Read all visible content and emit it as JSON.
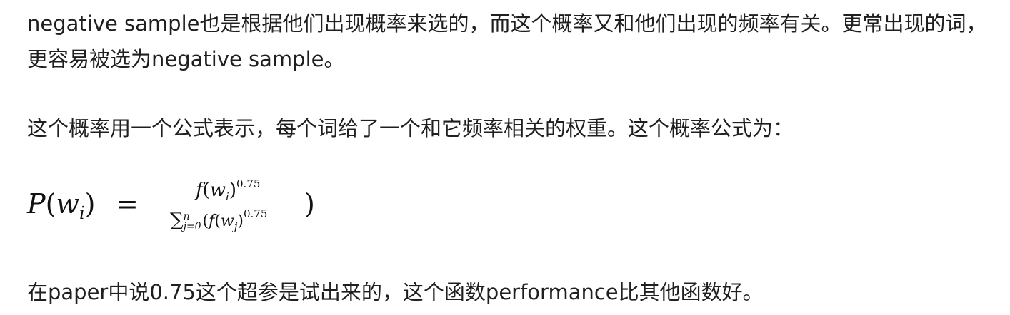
{
  "paragraphs": {
    "p1": "negative sample也是根据他们出现概率来选的，而这个概率又和他们出现的频率有关。更常出现的词，更容易被选为negative sample。",
    "p2": "这个概率用一个公式表示，每个词给了一个和它频率相关的权重。这个概率公式为：",
    "p3": "在paper中说0.75这个超参是试出来的，这个函数performance比其他函数好。"
  },
  "formula": {
    "lhs_func": "P",
    "lhs_var": "w",
    "lhs_sub": "i",
    "equals": "=",
    "num_func": "f",
    "num_var": "w",
    "num_sub": "i",
    "exponent": "0.75",
    "den_sum": "∑",
    "den_upper": "n",
    "den_lower": "j=0",
    "den_func": "f",
    "den_var": "w",
    "den_sub": "j",
    "den_exponent": "0.75",
    "trailing_paren": ")"
  }
}
